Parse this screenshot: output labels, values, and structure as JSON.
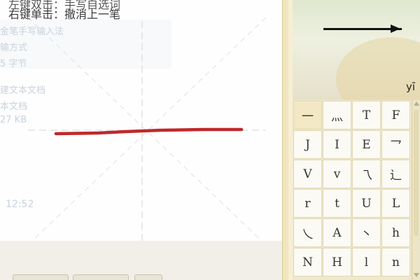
{
  "hints": {
    "line1": "左键双击：手写自选词",
    "line2": "右键单击：撤消上一笔"
  },
  "ghost_text": {
    "item1": "金笔手写输入法",
    "item2": "输方式",
    "item3": "5 字节",
    "item4": "建文本文档",
    "item5": "本文档",
    "item6": "27 KB",
    "time": "12:52"
  },
  "stroke": {
    "color": "#c0282a"
  },
  "preview": {
    "pinyin": "yī"
  },
  "candidates": [
    "一",
    "灬",
    "T",
    "F",
    "J",
    "I",
    "E",
    "乛",
    "V",
    "v",
    "乁",
    "辶",
    "r",
    "t",
    "U",
    "L",
    "乀",
    "A",
    "丶",
    "h",
    "N",
    "H",
    "l",
    "n"
  ]
}
